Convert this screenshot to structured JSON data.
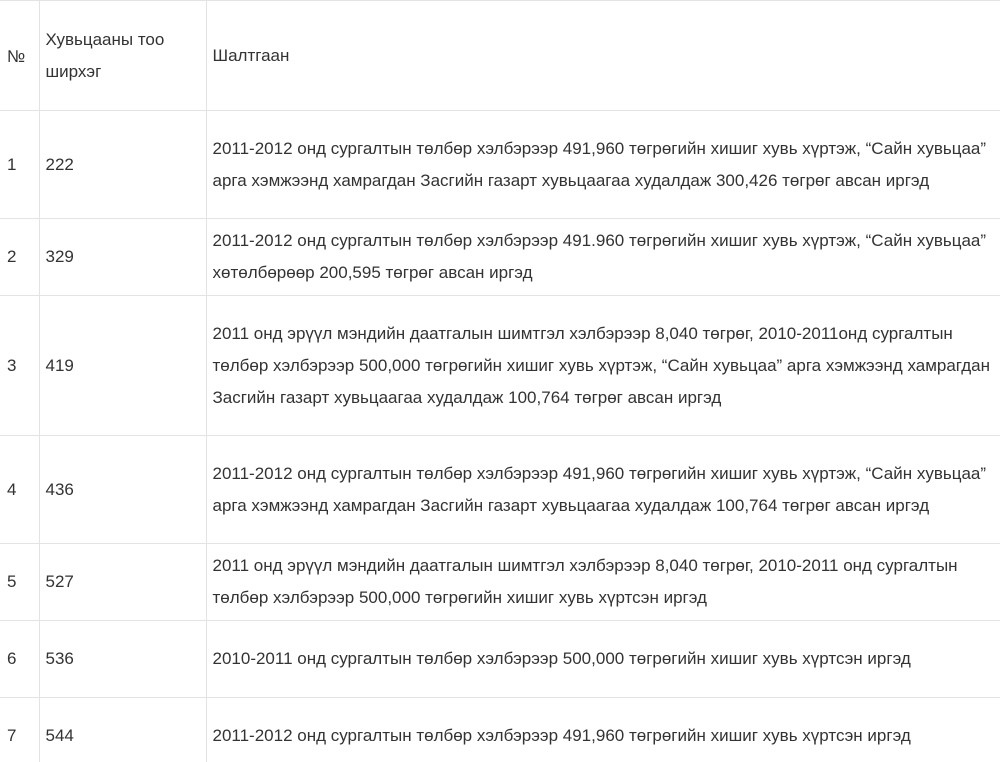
{
  "table": {
    "headers": {
      "number": "№",
      "quantity": "Хувьцааны тоо ширхэг",
      "reason": "Шалтгаан"
    },
    "rows": [
      {
        "number": "1",
        "quantity": "222",
        "reason": "2011-2012 онд сургалтын төлбөр хэлбэрээр 491,960 төгрөгийн хишиг хувь хүртэж, “Сайн хувьцаа” арга хэмжээнд хамрагдан Засгийн газарт хувьцаагаа худалдаж 300,426 төгрөг авсан иргэд"
      },
      {
        "number": "2",
        "quantity": "329",
        "reason": "2011-2012 онд сургалтын төлбөр хэлбэрээр 491.960 төгрөгийн хишиг хувь хүртэж, “Сайн хувьцаа” хөтөлбөрөөр 200,595 төгрөг авсан иргэд"
      },
      {
        "number": "3",
        "quantity": "419",
        "reason": "2011 онд эрүүл мэндийн даатгалын шимтгэл хэлбэрээр 8,040 төгрөг, 2010-2011онд сургалтын төлбөр хэлбэрээр 500,000 төгрөгийн хишиг хувь хүртэж, “Сайн хувьцаа” арга хэмжээнд хамрагдан Засгийн газарт хувьцаагаа худалдаж 100,764 төгрөг авсан иргэд"
      },
      {
        "number": "4",
        "quantity": "436",
        "reason": "2011-2012 онд сургалтын төлбөр хэлбэрээр 491,960 төгрөгийн хишиг хувь хүртэж, “Сайн хувьцаа” арга хэмжээнд хамрагдан Засгийн газарт хувьцаагаа худалдаж 100,764 төгрөг авсан иргэд"
      },
      {
        "number": "5",
        "quantity": "527",
        "reason": "2011 онд эрүүл мэндийн даатгалын шимтгэл хэлбэрээр 8,040 төгрөг, 2010-2011 онд сургалтын төлбөр хэлбэрээр 500,000 төгрөгийн хишиг хувь хүртсэн иргэд"
      },
      {
        "number": "6",
        "quantity": "536",
        "reason": "2010-2011 онд сургалтын төлбөр хэлбэрээр 500,000 төгрөгийн хишиг хувь хүртсэн иргэд"
      },
      {
        "number": "7",
        "quantity": "544",
        "reason": "2011-2012 онд сургалтын төлбөр хэлбэрээр 491,960 төгрөгийн хишиг хувь хүртсэн иргэд"
      }
    ]
  }
}
